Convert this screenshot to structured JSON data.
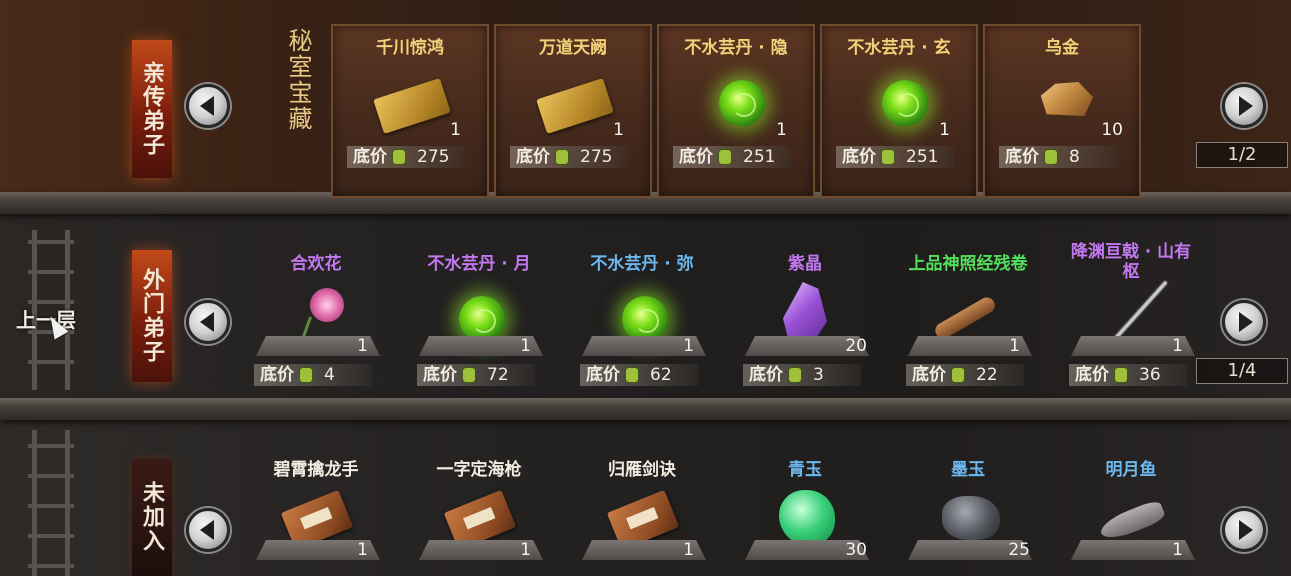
{
  "colors": {
    "gold": "#f4d27a",
    "white": "#f2ece2",
    "purple": "#c279f0",
    "blue": "#6cb8ef",
    "green": "#52e05c"
  },
  "price_label": "底价",
  "up_level": "上一层",
  "top": {
    "tab": "亲传弟子",
    "title": "秘室宝藏",
    "pager": "1/2",
    "items": [
      {
        "name": "千川惊鸿",
        "qty": "1",
        "price": "275",
        "icon": "scroll-icon"
      },
      {
        "name": "万道天阙",
        "qty": "1",
        "price": "275",
        "icon": "scroll-icon"
      },
      {
        "name": "不水芸丹 · 隐",
        "qty": "1",
        "price": "251",
        "icon": "green-pill-icon"
      },
      {
        "name": "不水芸丹 · 玄",
        "qty": "1",
        "price": "251",
        "icon": "green-pill-icon"
      },
      {
        "name": "乌金",
        "qty": "10",
        "price": "8",
        "icon": "ore-icon"
      }
    ]
  },
  "mid": {
    "tab": "外门弟子",
    "pager": "1/4",
    "items": [
      {
        "name": "合欢花",
        "qty": "1",
        "price": "4",
        "icon": "flower-icon"
      },
      {
        "name": "不水芸丹 · 月",
        "qty": "1",
        "price": "72",
        "icon": "green-pill-icon"
      },
      {
        "name": "不水芸丹 · 弥",
        "qty": "1",
        "price": "62",
        "icon": "green-pill-icon"
      },
      {
        "name": "紫晶",
        "qty": "20",
        "price": "3",
        "icon": "crystal-icon"
      },
      {
        "name": "上品神照经残卷",
        "qty": "1",
        "price": "22",
        "icon": "scroll-roll-icon"
      },
      {
        "name": "降渊亘戟 · 山有枢",
        "qty": "1",
        "price": "36",
        "icon": "halberd-icon"
      }
    ]
  },
  "bot": {
    "tab": "未加入",
    "items": [
      {
        "name": "碧霄擒龙手",
        "qty": "1",
        "icon": "book-icon"
      },
      {
        "name": "一字定海枪",
        "qty": "1",
        "icon": "book-icon"
      },
      {
        "name": "归雁剑诀",
        "qty": "1",
        "icon": "book-icon"
      },
      {
        "name": "青玉",
        "qty": "30",
        "icon": "green-jade-icon"
      },
      {
        "name": "墨玉",
        "qty": "25",
        "icon": "black-jade-icon"
      },
      {
        "name": "明月鱼",
        "qty": "1",
        "icon": "fish-icon"
      }
    ]
  }
}
